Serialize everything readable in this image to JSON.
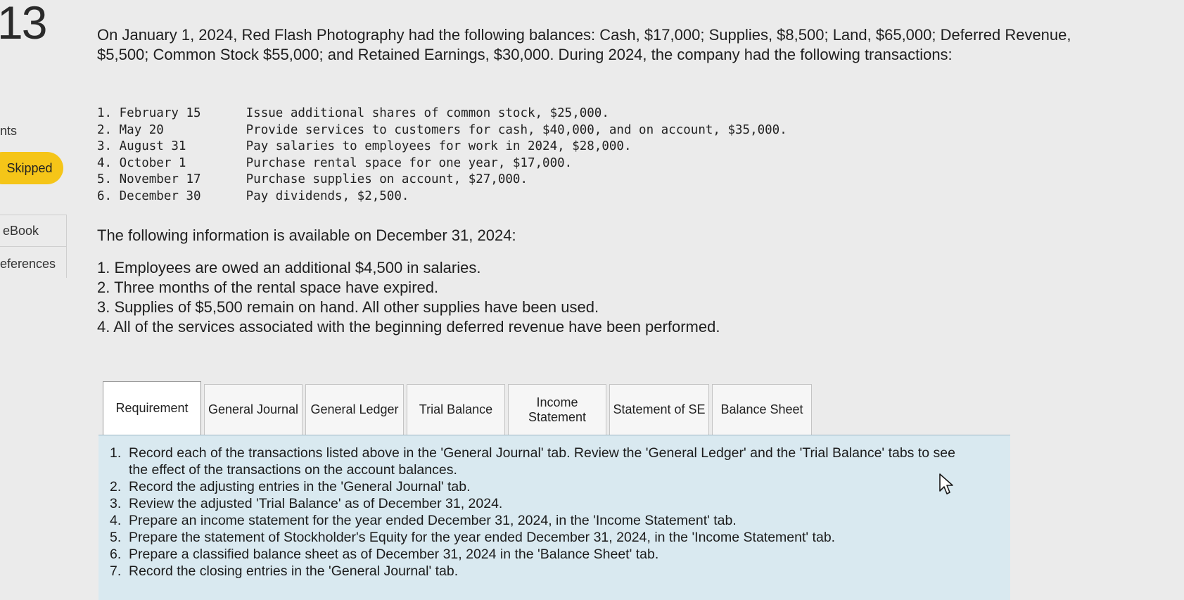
{
  "sidebar": {
    "question_number": "13",
    "points_label": "nts",
    "skipped_badge": "Skipped",
    "ebook_link": "eBook",
    "references_link": "eferences"
  },
  "problem": {
    "intro": "On January 1, 2024, Red Flash Photography had the following balances: Cash, $17,000; Supplies, $8,500; Land, $65,000; Deferred Revenue, $5,500; Common Stock $55,000; and Retained Earnings, $30,000. During 2024, the company had the following transactions:",
    "transactions": [
      {
        "num": "1.",
        "date": "February 15",
        "text": "Issue additional shares of common stock, $25,000."
      },
      {
        "num": "2.",
        "date": "May 20",
        "text": "Provide services to customers for cash, $40,000, and on account, $35,000."
      },
      {
        "num": "3.",
        "date": "August 31",
        "text": "Pay salaries to employees for work in 2024, $28,000."
      },
      {
        "num": "4.",
        "date": "October 1",
        "text": "Purchase rental space for one year, $17,000."
      },
      {
        "num": "5.",
        "date": "November 17",
        "text": "Purchase supplies on account, $27,000."
      },
      {
        "num": "6.",
        "date": "December 30",
        "text": "Pay dividends, $2,500."
      }
    ],
    "info_title": "The following information is available on December 31, 2024:",
    "info_items": [
      "1. Employees are owed an additional $4,500 in salaries.",
      "2. Three months of the rental space have expired.",
      "3. Supplies of $5,500 remain on hand. All other supplies have been used.",
      "4. All of the services associated with the beginning deferred revenue have been performed."
    ]
  },
  "tabs": [
    {
      "label": "Requirement",
      "active": true
    },
    {
      "label": "General Journal",
      "active": false
    },
    {
      "label": "General Ledger",
      "active": false
    },
    {
      "label": "Trial Balance",
      "active": false
    },
    {
      "label": "Income Statement",
      "active": false
    },
    {
      "label": "Statement of SE",
      "active": false
    },
    {
      "label": "Balance Sheet",
      "active": false
    }
  ],
  "requirements": [
    {
      "num": "1.",
      "text": "Record each of the transactions listed above in the 'General Journal' tab. Review the 'General Ledger' and the 'Trial Balance' tabs to see the effect of the transactions on the account balances."
    },
    {
      "num": "2.",
      "text": "Record the adjusting entries in the 'General Journal' tab."
    },
    {
      "num": "3.",
      "text": "Review the adjusted 'Trial Balance' as of December 31, 2024."
    },
    {
      "num": "4.",
      "text": "Prepare an income statement for the year ended December 31, 2024, in the 'Income Statement' tab."
    },
    {
      "num": "5.",
      "text": "Prepare the statement of Stockholder's Equity for the year ended December 31, 2024, in the 'Income Statement' tab."
    },
    {
      "num": "6.",
      "text": "Prepare a classified balance sheet as of December 31, 2024 in the 'Balance Sheet' tab."
    },
    {
      "num": "7.",
      "text": "Record the closing entries in the 'General Journal' tab."
    }
  ],
  "colors": {
    "skipped_badge": "#f5c518",
    "requirement_panel": "#d9e9f0"
  }
}
